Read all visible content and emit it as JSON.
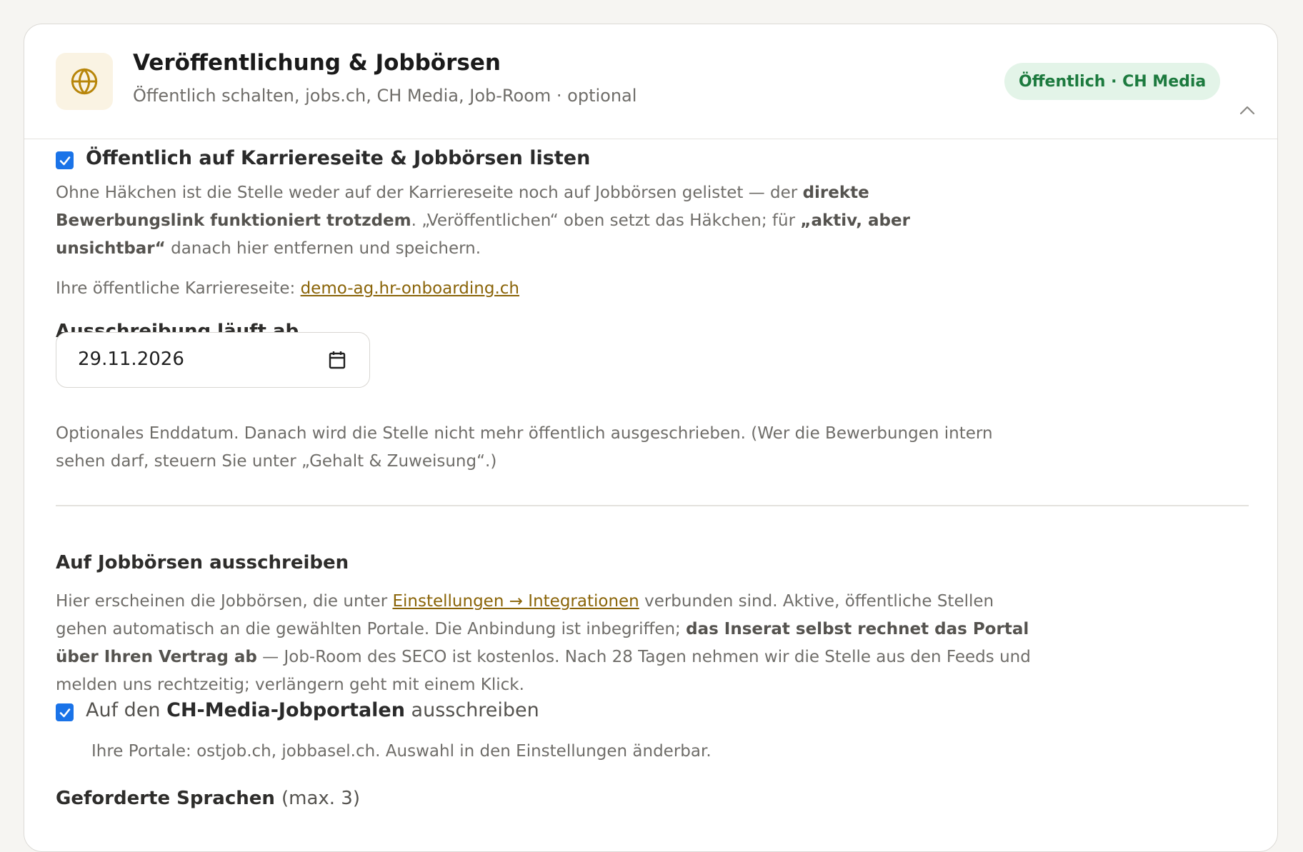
{
  "header": {
    "icon": "globe-icon",
    "title": "Veröffentlichung & Jobbörsen",
    "subtitle": "Öffentlich schalten, jobs.ch, CH Media, Job-Room · optional",
    "badge": "Öffentlich · CH Media",
    "collapse_icon": "chevron-up-icon"
  },
  "colors": {
    "accent": "#8a6408",
    "badge_bg": "#e3f4e8",
    "badge_text": "#1c7a3e",
    "checkbox": "#1a73e8"
  },
  "listing": {
    "checked": true,
    "label": "Öffentlich auf Karriereseite & Jobbörsen listen",
    "desc_1": "Ohne Häkchen ist die Stelle weder auf der Karriereseite noch auf Jobbörsen gelistet — der ",
    "desc_bold_1": "direkte Bewerbungslink funktioniert trotzdem",
    "desc_2": ". „Veröffentlichen“ oben setzt das Häkchen; für ",
    "desc_bold_2": "„aktiv, aber unsichtbar“",
    "desc_3": " danach hier entfernen und speichern.",
    "career_prefix": "Ihre öffentliche Karriereseite: ",
    "career_link": "demo-ag.hr-onboarding.ch"
  },
  "expiry": {
    "label": "Ausschreibung läuft ab",
    "value": "29.11.2026",
    "calendar_icon": "calendar-icon",
    "hint": "Optionales Enddatum. Danach wird die Stelle nicht mehr öffentlich ausgeschrieben. (Wer die Bewerbungen intern sehen darf, steuern Sie unter „Gehalt & Zuweisung“.)"
  },
  "jobboards": {
    "title": "Auf Jobbörsen ausschreiben",
    "desc_1": "Hier erscheinen die Jobbörsen, die unter ",
    "desc_link": "Einstellungen → Integrationen",
    "desc_2": " verbunden sind. Aktive, öffentliche Stellen gehen automatisch an die gewählten Portale. Die Anbindung ist inbegriffen; ",
    "desc_bold": "das Inserat selbst rechnet das Portal über Ihren Vertrag ab",
    "desc_3": " — Job-Room des SECO ist kostenlos. Nach 28 Tagen nehmen wir die Stelle aus den Feeds und melden uns rechtzeitig; verlängern geht mit einem Klick.",
    "chmedia_checked": true,
    "chmedia_prefix": "Auf den ",
    "chmedia_bold": "CH-Media-Jobportalen",
    "chmedia_suffix": " ausschreiben",
    "chmedia_hint": "Ihre Portale: ostjob.ch, jobbasel.ch. Auswahl in den Einstellungen änderbar."
  },
  "languages": {
    "title": "Geforderte Sprachen",
    "suffix": "(max. 3)"
  }
}
